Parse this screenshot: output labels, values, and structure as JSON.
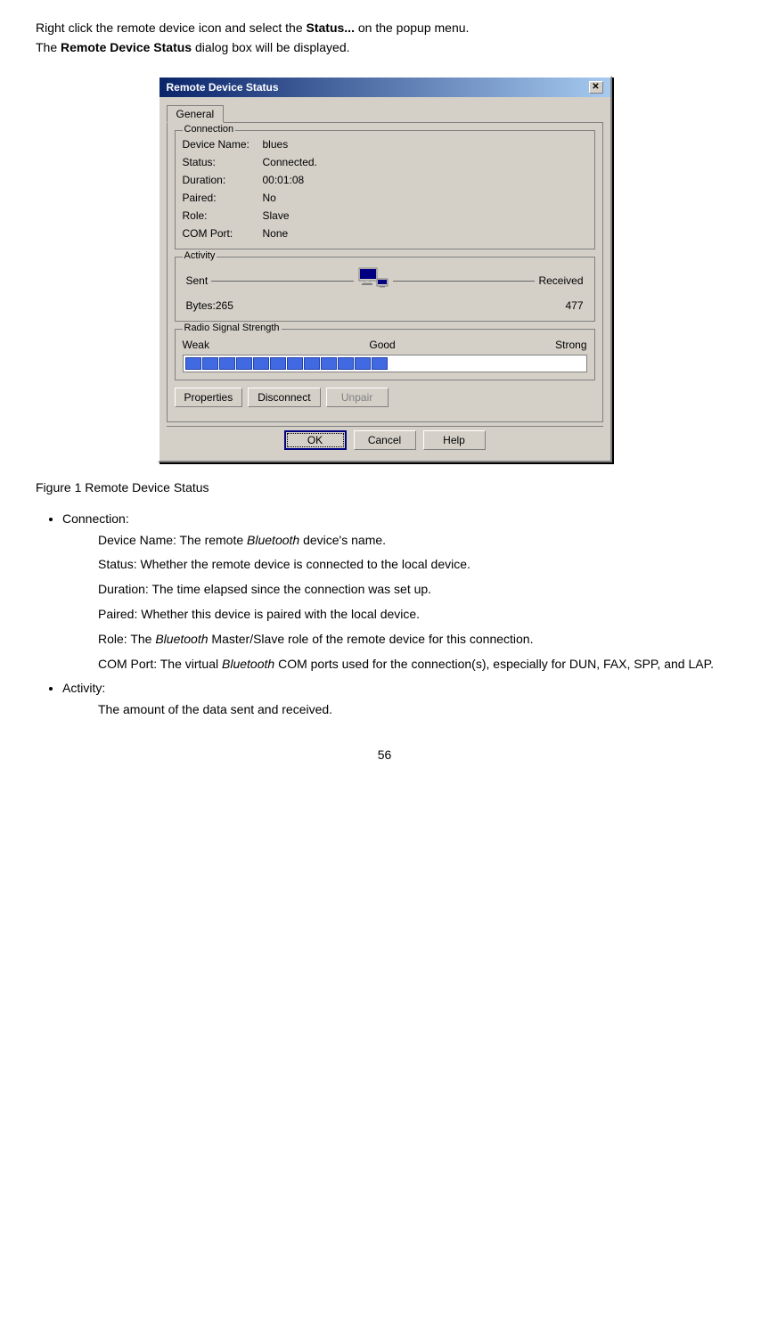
{
  "intro": {
    "line1": "Right click the remote device icon and select the ",
    "line1_bold": "Status...",
    "line1_end": " on the popup menu.",
    "line2": "The ",
    "line2_bold": "Remote Device Status",
    "line2_end": " dialog box will be displayed."
  },
  "dialog": {
    "title": "Remote Device Status",
    "close_btn": "✕",
    "tab_general": "General",
    "connection": {
      "legend": "Connection",
      "fields": [
        {
          "label": "Device Name:",
          "value": "blues"
        },
        {
          "label": "Status:",
          "value": "Connected."
        },
        {
          "label": "Duration:",
          "value": "00:01:08"
        },
        {
          "label": "Paired:",
          "value": "No"
        },
        {
          "label": "Role:",
          "value": "Slave"
        },
        {
          "label": "COM Port:",
          "value": "None"
        }
      ]
    },
    "activity": {
      "legend": "Activity",
      "sent_label": "Sent",
      "received_label": "Received",
      "bytes_label": "Bytes:",
      "bytes_sent": "265",
      "bytes_received": "477"
    },
    "signal": {
      "legend": "Radio Signal Strength",
      "weak_label": "Weak",
      "good_label": "Good",
      "strong_label": "Strong",
      "fill_blocks": 12
    },
    "buttons": {
      "properties": "Properties",
      "disconnect": "Disconnect",
      "unpair": "Unpair"
    },
    "footer": {
      "ok": "OK",
      "cancel": "Cancel",
      "help": "Help"
    }
  },
  "figure_caption": "Figure 1 Remote Device Status",
  "bullets": [
    {
      "label": "Connection:",
      "items": [
        {
          "text_start": "Device Name: The remote ",
          "italic": "Bluetooth",
          "text_end": " device's name."
        },
        {
          "text": "Status: Whether the remote device is connected to the local device."
        },
        {
          "text": "Duration: The time elapsed since the connection was set up."
        },
        {
          "text": "Paired: Whether this device is paired with the local device."
        },
        {
          "text_start": "Role: The ",
          "italic": "Bluetooth",
          "text_end": " Master/Slave role of the remote device for this connection."
        },
        {
          "text_start": "COM Port: The virtual ",
          "italic": "Bluetooth",
          "text_end": " COM ports used for the connection(s), especially for DUN, FAX, SPP, and LAP."
        }
      ]
    },
    {
      "label": "Activity:",
      "items": [
        {
          "text": "The amount of the data sent and received."
        }
      ]
    }
  ],
  "page_number": "56"
}
